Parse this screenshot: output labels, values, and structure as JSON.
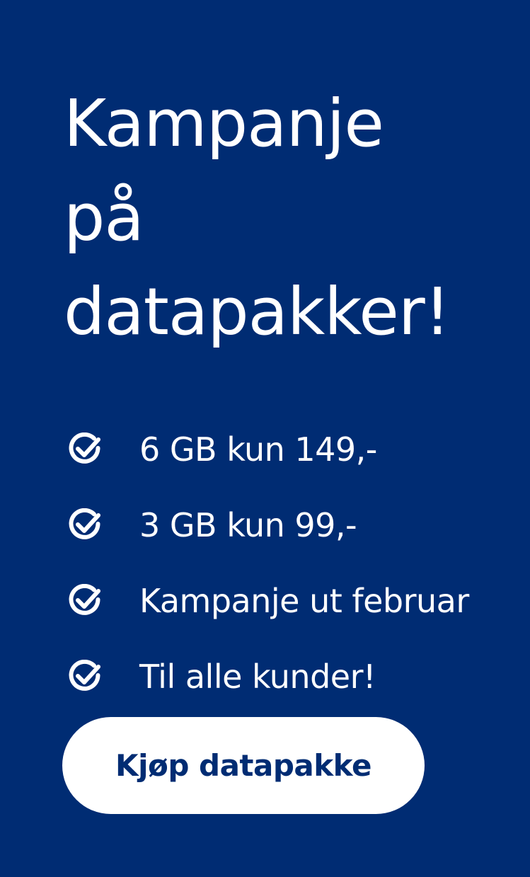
{
  "banner": {
    "headline_lines": [
      "Kampanje",
      "på",
      "datapakker!"
    ],
    "features": [
      {
        "icon": "check-circle-icon",
        "text": "6 GB kun 149,-"
      },
      {
        "icon": "check-circle-icon",
        "text": "3 GB kun 99,-"
      },
      {
        "icon": "check-circle-icon",
        "text": "Kampanje ut februar"
      },
      {
        "icon": "check-circle-icon",
        "text": "Til alle kunder!"
      }
    ],
    "cta_label": "Kjøp datapakke"
  },
  "colors": {
    "background": "#002c73",
    "text": "#ffffff",
    "button_background": "#ffffff",
    "button_text": "#002c73"
  }
}
